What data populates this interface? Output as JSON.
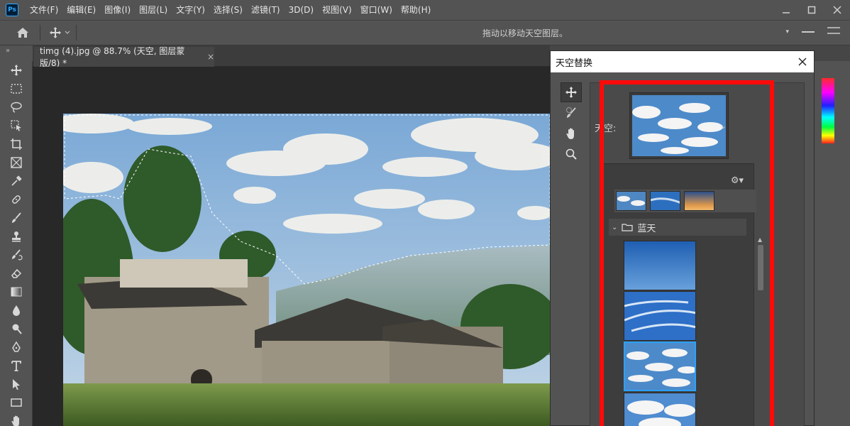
{
  "app": {
    "logo_text": "Ps",
    "menu": [
      "文件(F)",
      "编辑(E)",
      "图像(I)",
      "图层(L)",
      "文字(Y)",
      "选择(S)",
      "滤镜(T)",
      "3D(D)",
      "视图(V)",
      "窗口(W)",
      "帮助(H)"
    ],
    "window_controls": [
      "minimize-icon",
      "maximize-icon",
      "close-icon"
    ]
  },
  "options_bar": {
    "hint": "拖动以移动天空图层。"
  },
  "document": {
    "tab_label": "timg (4).jpg @ 88.7% (天空, 图层蒙版/8) *",
    "close_label": "×"
  },
  "tools": [
    "move-tool",
    "marquee-tool",
    "lasso-tool",
    "object-select-tool",
    "crop-tool",
    "frame-tool",
    "eyedropper-tool",
    "healing-tool",
    "brush-tool",
    "stamp-tool",
    "history-brush-tool",
    "eraser-tool",
    "gradient-tool",
    "blur-tool",
    "dodge-tool",
    "pen-tool",
    "type-tool",
    "path-select-tool",
    "rectangle-tool",
    "hand-tool"
  ],
  "dialog": {
    "title": "天空替换",
    "sky_label": "天空:",
    "group_name": "蓝天",
    "tools": [
      "move-sky-tool",
      "sky-brush-tool",
      "hand-tool",
      "zoom-tool"
    ],
    "accent_color": "#2aa2ff",
    "highlight_color": "#ff0a0a"
  }
}
